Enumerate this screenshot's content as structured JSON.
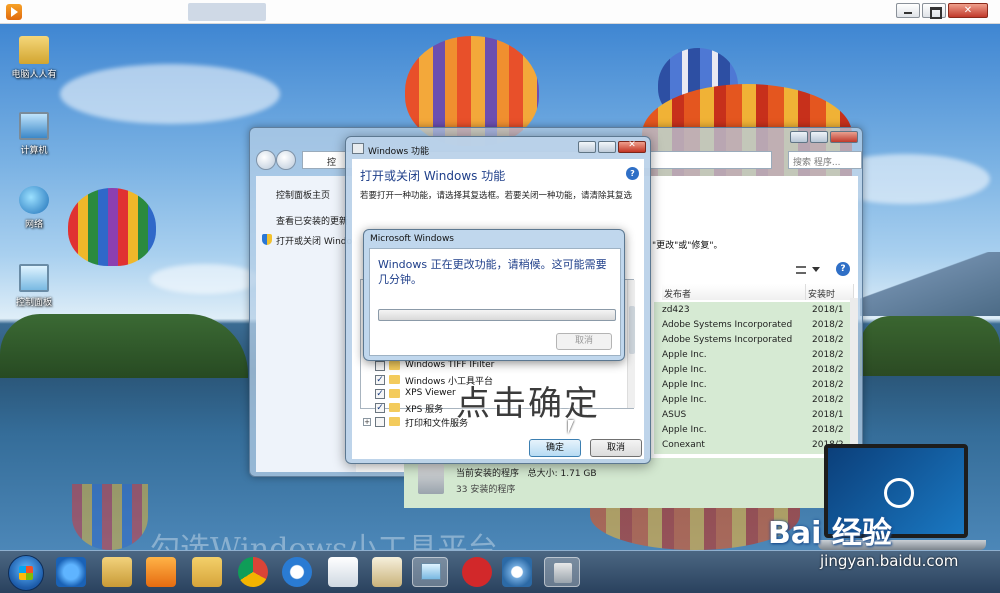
{
  "desktop_icons": [
    {
      "label": "电脑人人有"
    },
    {
      "label": "计算机"
    },
    {
      "label": "网络"
    },
    {
      "label": "控制面板"
    }
  ],
  "control_panel": {
    "address_fragment": "控",
    "search_placeholder": "搜索 程序...",
    "sidebar_links": [
      "控制面板主页",
      "查看已安装的更新",
      "打开或关闭 Windows 功能"
    ],
    "hint_text": "\"更改\"或\"修复\"。",
    "columns": {
      "publisher": "发布者",
      "installed_on": "安装时"
    },
    "rows": [
      {
        "publisher": "zd423",
        "date": "2018/1"
      },
      {
        "publisher": "Adobe Systems Incorporated",
        "date": "2018/2"
      },
      {
        "publisher": "Adobe Systems Incorporated",
        "date": "2018/2"
      },
      {
        "publisher": "Apple Inc.",
        "date": "2018/2"
      },
      {
        "publisher": "Apple Inc.",
        "date": "2018/2"
      },
      {
        "publisher": "Apple Inc.",
        "date": "2018/2"
      },
      {
        "publisher": "Apple Inc.",
        "date": "2018/2"
      },
      {
        "publisher": "ASUS",
        "date": "2018/1"
      },
      {
        "publisher": "Apple Inc.",
        "date": "2018/2"
      },
      {
        "publisher": "Conexant",
        "date": "2018/2"
      }
    ],
    "status_title": "当前安装的程序",
    "status_size": "总大小: 1.71 GB",
    "status_count": "33 安装的程序"
  },
  "windows_features": {
    "title": "Windows 功能",
    "heading": "打开或关闭 Windows 功能",
    "description": "若要打开一种功能，请选择其复选框。若要关闭一种功能，请清除其复选",
    "items": [
      {
        "label": "Windows TIFF IFilter",
        "checked": false
      },
      {
        "label": "Windows 小工具平台",
        "checked": true
      },
      {
        "label": "XPS Viewer",
        "checked": true
      },
      {
        "label": "XPS 服务",
        "checked": true
      },
      {
        "label": "打印和文件服务",
        "checked": false,
        "expandable": true
      }
    ],
    "ok_label": "确定",
    "cancel_label": "取消"
  },
  "progress_dialog": {
    "title": "Microsoft Windows",
    "message": "Windows 正在更改功能，请稍候。这可能需要几分钟。",
    "progress": 0,
    "cancel_label": "取消"
  },
  "annotations": {
    "confirm": "点击确定",
    "bottom": "勾选Windows小工具平台"
  },
  "watermark": {
    "brand": "Bai 经验",
    "url": "jingyan.baidu.com"
  },
  "taskbar": {
    "icons": [
      "ie-icon",
      "explorer-icon",
      "media-player-icon",
      "folder-icon",
      "chrome-icon",
      "browser-icon",
      "document-icon",
      "paint-icon",
      "control-panel-icon",
      "game-icon",
      "pinwheel-icon",
      "features-icon"
    ]
  }
}
